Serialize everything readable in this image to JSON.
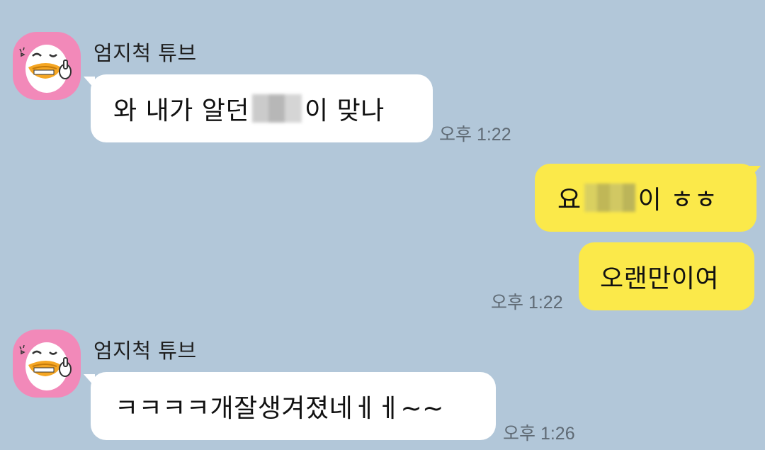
{
  "colors": {
    "background": "#b2c7d9",
    "incoming_bubble": "#ffffff",
    "outgoing_bubble": "#fbe94a",
    "avatar": "#f289b9"
  },
  "messages": {
    "group1": {
      "sender": "엄지척 튜브",
      "avatar_icon": "tube-duck-thumbs-up-icon",
      "text_before": "와 내가 알던 ",
      "text_after": "이 맞나",
      "time": "오후 1:22"
    },
    "group2": {
      "bubble1_before": "요 ",
      "bubble1_after": "이 ㅎㅎ",
      "bubble2": "오랜만이여",
      "time": "오후 1:22"
    },
    "group3": {
      "sender": "엄지척 튜브",
      "avatar_icon": "tube-duck-thumbs-up-icon",
      "text": "ㅋㅋㅋㅋ개잘생겨졌네ㅔㅔ~~",
      "time": "오후 1:26"
    }
  }
}
